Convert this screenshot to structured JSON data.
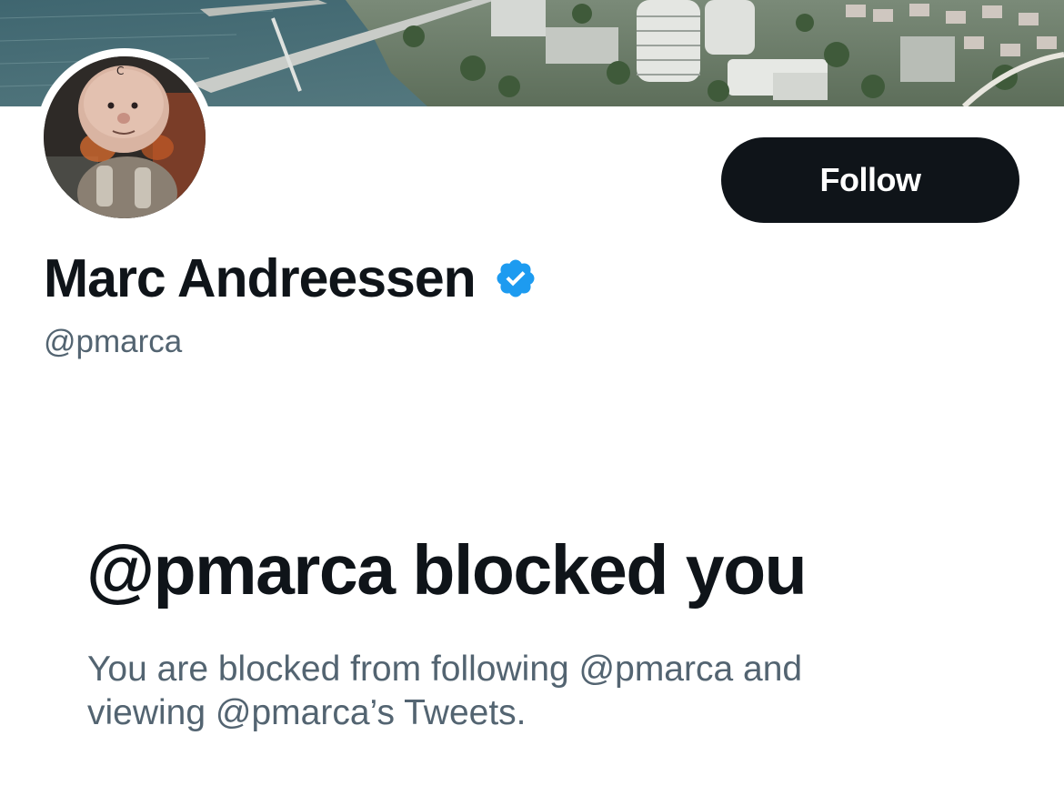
{
  "profile": {
    "display_name": "Marc Andreessen",
    "handle": "@pmarca",
    "verified": true
  },
  "actions": {
    "follow_label": "Follow"
  },
  "blocked": {
    "title": "@pmarca blocked you",
    "description": "You are blocked from following @pmarca and viewing @pmarca’s Tweets."
  },
  "icons": {
    "verified": "verified-badge-icon",
    "banner": "banner-image",
    "avatar": "avatar-image"
  },
  "colors": {
    "primary_text": "#0f1419",
    "secondary_text": "#536471",
    "verified_blue": "#1d9bf0",
    "follow_button_bg": "#0f1419",
    "background": "#ffffff"
  }
}
